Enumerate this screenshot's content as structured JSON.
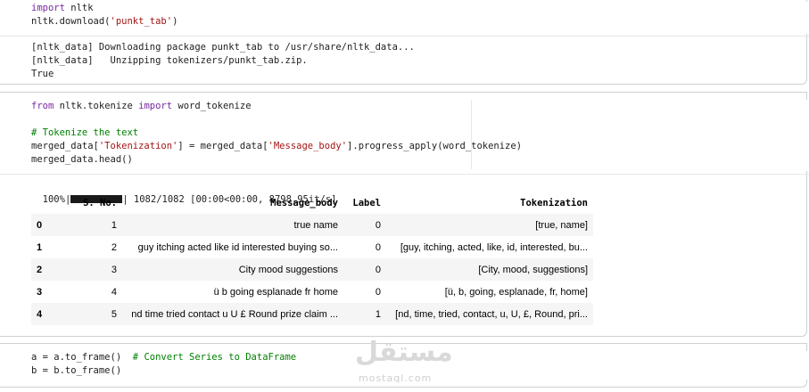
{
  "cell1": {
    "code": [
      {
        "parts": [
          {
            "t": "import",
            "c": "kw"
          },
          {
            "t": " nltk",
            "c": ""
          }
        ]
      },
      {
        "parts": [
          {
            "t": "nltk.download(",
            "c": ""
          },
          {
            "t": "'punkt_tab'",
            "c": "str"
          },
          {
            "t": ")",
            "c": ""
          }
        ]
      }
    ],
    "output": [
      "[nltk_data] Downloading package punkt_tab to /usr/share/nltk_data...",
      "[nltk_data]   Unzipping tokenizers/punkt_tab.zip.",
      "True"
    ]
  },
  "cell2": {
    "code": [
      {
        "parts": [
          {
            "t": "from",
            "c": "kw"
          },
          {
            "t": " nltk.tokenize ",
            "c": ""
          },
          {
            "t": "import",
            "c": "kw"
          },
          {
            "t": " word_tokenize",
            "c": ""
          }
        ]
      },
      {
        "parts": [
          {
            "t": "",
            "c": ""
          }
        ]
      },
      {
        "parts": [
          {
            "t": "# Tokenize the text",
            "c": "cmt"
          }
        ]
      },
      {
        "parts": [
          {
            "t": "merged_data[",
            "c": ""
          },
          {
            "t": "'Tokenization'",
            "c": "str"
          },
          {
            "t": "] = merged_data[",
            "c": ""
          },
          {
            "t": "'Message_body'",
            "c": "str"
          },
          {
            "t": "].progress_apply(word_tokenize)",
            "c": ""
          }
        ]
      },
      {
        "parts": [
          {
            "t": "merged_data.head()",
            "c": ""
          }
        ]
      }
    ],
    "progress": {
      "prefix": "100%|",
      "suffix": "| 1082/1082 [00:00<00:00, 8798.95it/s]",
      "fraction": 1.0
    },
    "table": {
      "columns": [
        "",
        "S. No.",
        "Message_body",
        "Label",
        "Tokenization"
      ],
      "rows": [
        [
          "0",
          "1",
          "true name",
          "0",
          "[true, name]"
        ],
        [
          "1",
          "2",
          "guy itching acted like id interested buying so...",
          "0",
          "[guy, itching, acted, like, id, interested, bu..."
        ],
        [
          "2",
          "3",
          "City mood suggestions",
          "0",
          "[City, mood, suggestions]"
        ],
        [
          "3",
          "4",
          "ü b going esplanade fr home",
          "0",
          "[ü, b, going, esplanade, fr, home]"
        ],
        [
          "4",
          "5",
          "nd time tried contact u U £ Round prize claim ...",
          "1",
          "[nd, time, tried, contact, u, U, £, Round, pri..."
        ]
      ]
    }
  },
  "cell3": {
    "code": [
      {
        "parts": [
          {
            "t": "a = a.to_frame()  ",
            "c": ""
          },
          {
            "t": "# Convert Series to DataFrame",
            "c": "cmt"
          }
        ]
      },
      {
        "parts": [
          {
            "t": "b = b.to_frame()",
            "c": ""
          }
        ]
      }
    ]
  },
  "watermark": {
    "logo": "مستقل",
    "url": "mostaql.com"
  }
}
